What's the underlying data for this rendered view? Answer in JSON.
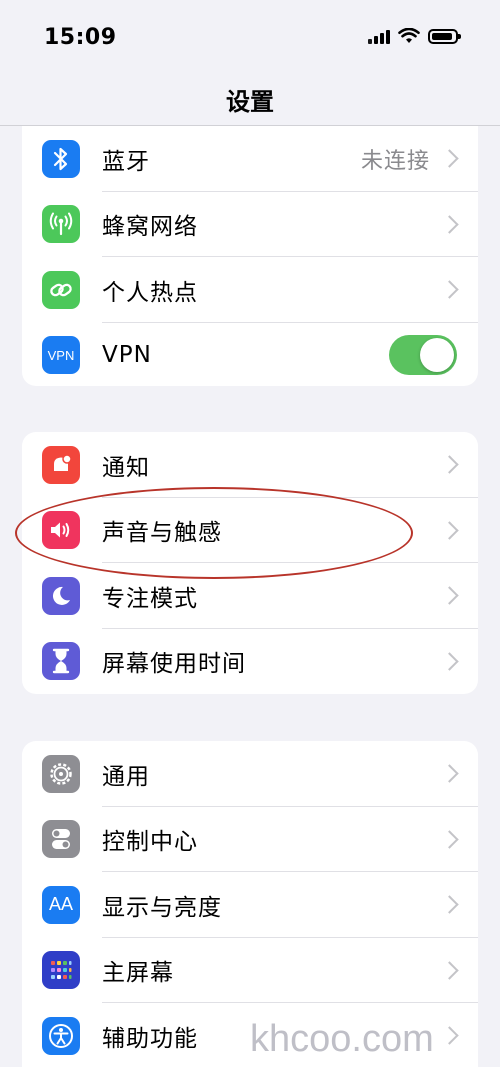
{
  "status_bar": {
    "time": "15:09"
  },
  "nav": {
    "title": "设置"
  },
  "group1": [
    {
      "label": "蓝牙",
      "icon": "bluetooth-icon",
      "color": "#1a7cf2",
      "value": "未连接"
    },
    {
      "label": "蜂窝网络",
      "icon": "cellular-antenna-icon",
      "color": "#4cc85a"
    },
    {
      "label": "个人热点",
      "icon": "hotspot-link-icon",
      "color": "#4cc85a"
    },
    {
      "label": "VPN",
      "icon": "vpn-icon",
      "icon_text": "VPN",
      "color": "#1a7cf2",
      "toggle": true
    }
  ],
  "group2": [
    {
      "label": "通知",
      "icon": "notification-bell-icon",
      "color": "#f2463c"
    },
    {
      "label": "声音与触感",
      "icon": "speaker-icon",
      "color": "#f0345e",
      "highlighted": true
    },
    {
      "label": "专注模式",
      "icon": "moon-icon",
      "color": "#5f5bd6"
    },
    {
      "label": "屏幕使用时间",
      "icon": "hourglass-icon",
      "color": "#5f5bd6"
    }
  ],
  "group3": [
    {
      "label": "通用",
      "icon": "gear-icon",
      "color": "#8e8e93"
    },
    {
      "label": "控制中心",
      "icon": "toggles-icon",
      "color": "#8e8e93"
    },
    {
      "label": "显示与亮度",
      "icon": "display-aa-icon",
      "icon_text": "AA",
      "color": "#1a7cf2"
    },
    {
      "label": "主屏幕",
      "icon": "home-grid-icon",
      "color": "#2f3ec7"
    },
    {
      "label": "辅助功能",
      "icon": "accessibility-icon",
      "color": "#1a7cf2"
    }
  ],
  "watermark": "khcoo.com"
}
